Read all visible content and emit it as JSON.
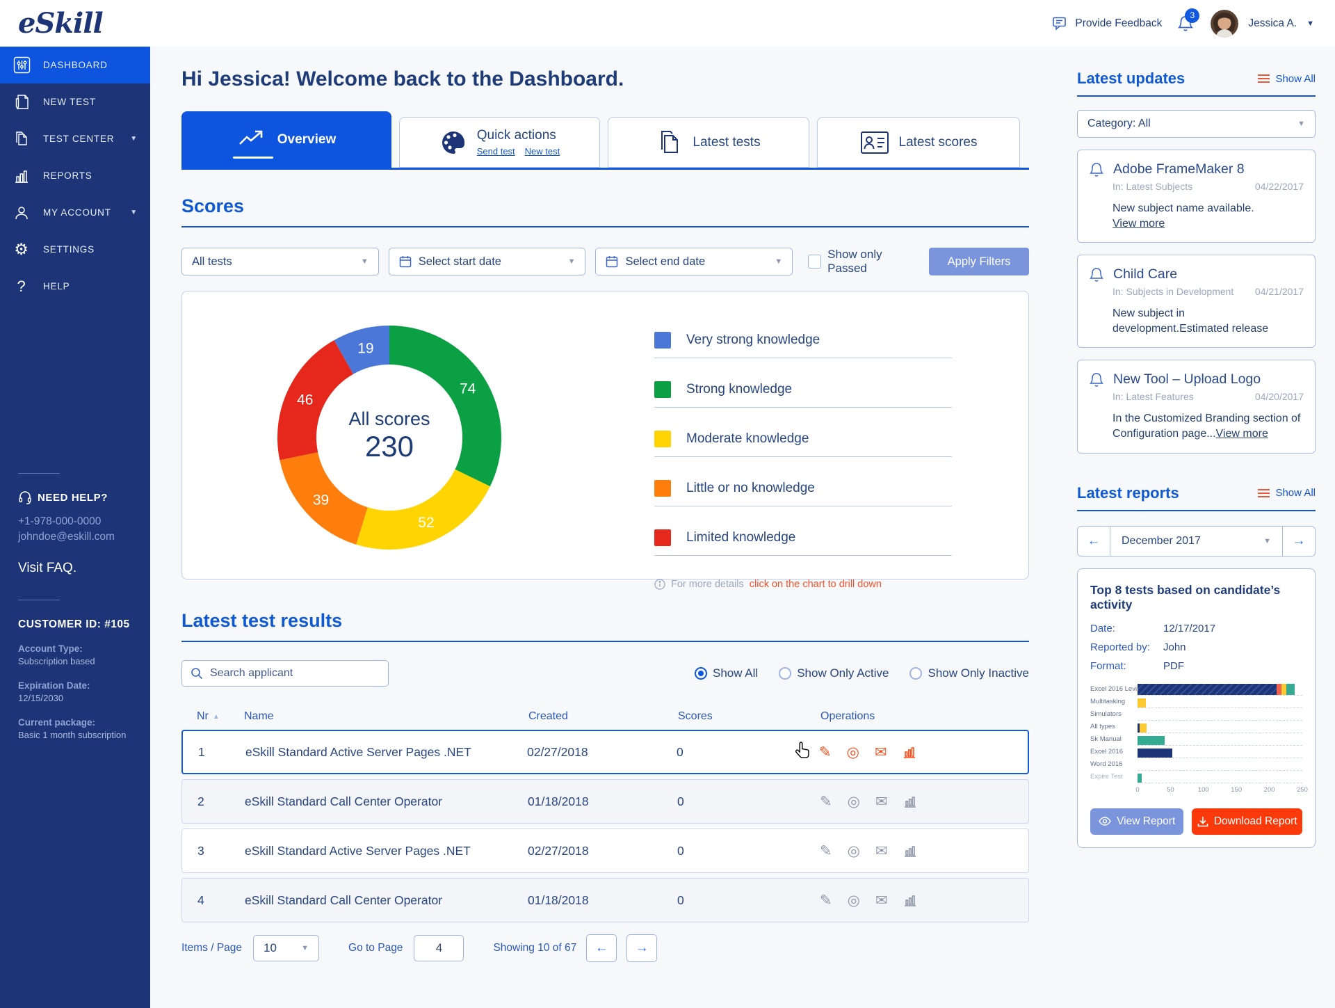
{
  "header": {
    "logo": "eSkill",
    "feedback_label": "Provide Feedback",
    "notification_count": "3",
    "user_name": "Jessica A."
  },
  "sidebar": {
    "items": [
      {
        "label": "DASHBOARD"
      },
      {
        "label": "NEW TEST"
      },
      {
        "label": "TEST CENTER"
      },
      {
        "label": "REPORTS"
      },
      {
        "label": "MY ACCOUNT"
      },
      {
        "label": "SETTINGS"
      },
      {
        "label": "HELP"
      }
    ],
    "help": {
      "title": "NEED HELP?",
      "phone": "+1-978-000-0000",
      "email": "johndoe@eskill.com",
      "faq": "Visit FAQ."
    },
    "customer": {
      "title": "CUSTOMER ID: #105",
      "account_type_label": "Account Type:",
      "account_type": "Subscription based",
      "expiration_label": "Expiration Date:",
      "expiration": "12/15/2030",
      "package_label": "Current package:",
      "package": "Basic 1 month subscription"
    }
  },
  "main": {
    "greeting": "Hi Jessica! Welcome back to the Dashboard.",
    "tabs": {
      "overview": "Overview",
      "quick_actions": "Quick actions",
      "send_test": "Send test",
      "new_test": "New test",
      "latest_tests": "Latest tests",
      "latest_scores": "Latest scores"
    },
    "scores": {
      "title": "Scores",
      "filter_tests": "All tests",
      "filter_start": "Select start date",
      "filter_end": "Select end date",
      "filter_passed": "Show only Passed",
      "apply": "Apply Filters",
      "note_plain": "For more details",
      "note_link": "click on the chart to drill down",
      "legend": [
        {
          "label": "Very strong knowledge",
          "color": "#4a77d8"
        },
        {
          "label": "Strong knowledge",
          "color": "#0ba044"
        },
        {
          "label": "Moderate knowledge",
          "color": "#fed402"
        },
        {
          "label": "Little or no knowledge",
          "color": "#fd7e0d"
        },
        {
          "label": "Limited knowledge",
          "color": "#e5281b"
        }
      ]
    },
    "results": {
      "title": "Latest test results",
      "search_placeholder": "Search applicant",
      "radios": [
        "Show All",
        "Show Only Active",
        "Show Only Inactive"
      ],
      "columns": [
        "Nr",
        "Name",
        "Created",
        "Scores",
        "Operations"
      ],
      "rows": [
        {
          "nr": "1",
          "name": "eSkill Standard Active Server Pages .NET",
          "created": "02/27/2018",
          "score": "0"
        },
        {
          "nr": "2",
          "name": "eSkill Standard Call Center Operator",
          "created": "01/18/2018",
          "score": "0"
        },
        {
          "nr": "3",
          "name": "eSkill Standard Active Server Pages .NET",
          "created": "02/27/2018",
          "score": "0"
        },
        {
          "nr": "4",
          "name": "eSkill Standard Call Center Operator",
          "created": "01/18/2018",
          "score": "0"
        }
      ],
      "pagination": {
        "items_label": "Items / Page",
        "items_value": "10",
        "goto_label": "Go to Page",
        "page_value": "4",
        "showing": "Showing 10 of 67"
      }
    }
  },
  "updates": {
    "title": "Latest updates",
    "show_all": "Show All",
    "category": "Category: All",
    "cards": [
      {
        "title": "Adobe FrameMaker 8",
        "in": "In: Latest Subjects",
        "date": "04/22/2017",
        "body": "New subject name available.",
        "link": "View more"
      },
      {
        "title": "Child Care",
        "in": "In: Subjects in Development",
        "date": "04/21/2017",
        "body": "New subject in development.Estimated release",
        "link": ""
      },
      {
        "title": "New Tool – Upload Logo",
        "in": "In: Latest Features",
        "date": "04/20/2017",
        "body": "In the Customized Branding section of Configuration page...",
        "link": "View more"
      }
    ]
  },
  "reports": {
    "title": "Latest reports",
    "show_all": "Show All",
    "month": "December 2017",
    "card_title": "Top 8 tests based on candidate’s activity",
    "date_label": "Date:",
    "date": "12/17/2017",
    "by_label": "Reported by:",
    "by": "John",
    "format_label": "Format:",
    "format": "PDF",
    "view_btn": "View Report",
    "download_btn": "Download Report"
  },
  "colors": {
    "sidebar_navy": "#1d3576",
    "active_blue": "#0d54de",
    "accent_blue": "#1155d4",
    "periwinkle_button": "#7b95dc",
    "download_red": "#fb3a0b",
    "row_highlight_border": "#1259e0",
    "ops_icon_active": "#f4511e"
  },
  "chart_data": [
    {
      "type": "pie",
      "variant": "donut",
      "center_label": "All scores",
      "center_value": 230,
      "segments_clockwise_from_top": [
        {
          "label": "Strong knowledge",
          "value": 74,
          "color": "#0ba044"
        },
        {
          "label": "Moderate knowledge",
          "value": 52,
          "color": "#fed402"
        },
        {
          "label": "Little or no knowledge",
          "value": 39,
          "color": "#fd7e0d"
        },
        {
          "label": "Limited knowledge",
          "value": 46,
          "color": "#e5281b"
        },
        {
          "label": "Very strong knowledge",
          "value": 19,
          "color": "#4a77d8"
        }
      ]
    },
    {
      "type": "bar",
      "orientation": "horizontal",
      "title": "Top 8 tests based on candidate’s activity",
      "categories": [
        "Excel 2016 Levi",
        "Multitasking",
        "Simulators",
        "All types",
        "Sk Manual",
        "Excel 2016",
        "Word 2016",
        "Expire Test"
      ],
      "xlim": [
        0,
        250
      ],
      "ticks": [
        0,
        50,
        100,
        150,
        200,
        250
      ],
      "palette": {
        "navy": "#1d3576",
        "red": "#f0624d",
        "yellow": "#fdc931",
        "teal": "#35ab93"
      },
      "bars": [
        [
          {
            "color": "navy",
            "value": 194,
            "hatch": true
          },
          {
            "color": "red",
            "value": 7
          },
          {
            "color": "yellow",
            "value": 6
          },
          {
            "color": "teal",
            "value": 12
          }
        ],
        [
          {
            "color": "yellow",
            "value": 12
          }
        ],
        [],
        [
          {
            "color": "navy",
            "value": 3
          },
          {
            "color": "yellow",
            "value": 10
          }
        ],
        [
          {
            "color": "teal",
            "value": 38
          }
        ],
        [
          {
            "color": "navy",
            "value": 48
          }
        ],
        [],
        [
          {
            "color": "teal",
            "value": 6
          }
        ]
      ]
    }
  ]
}
